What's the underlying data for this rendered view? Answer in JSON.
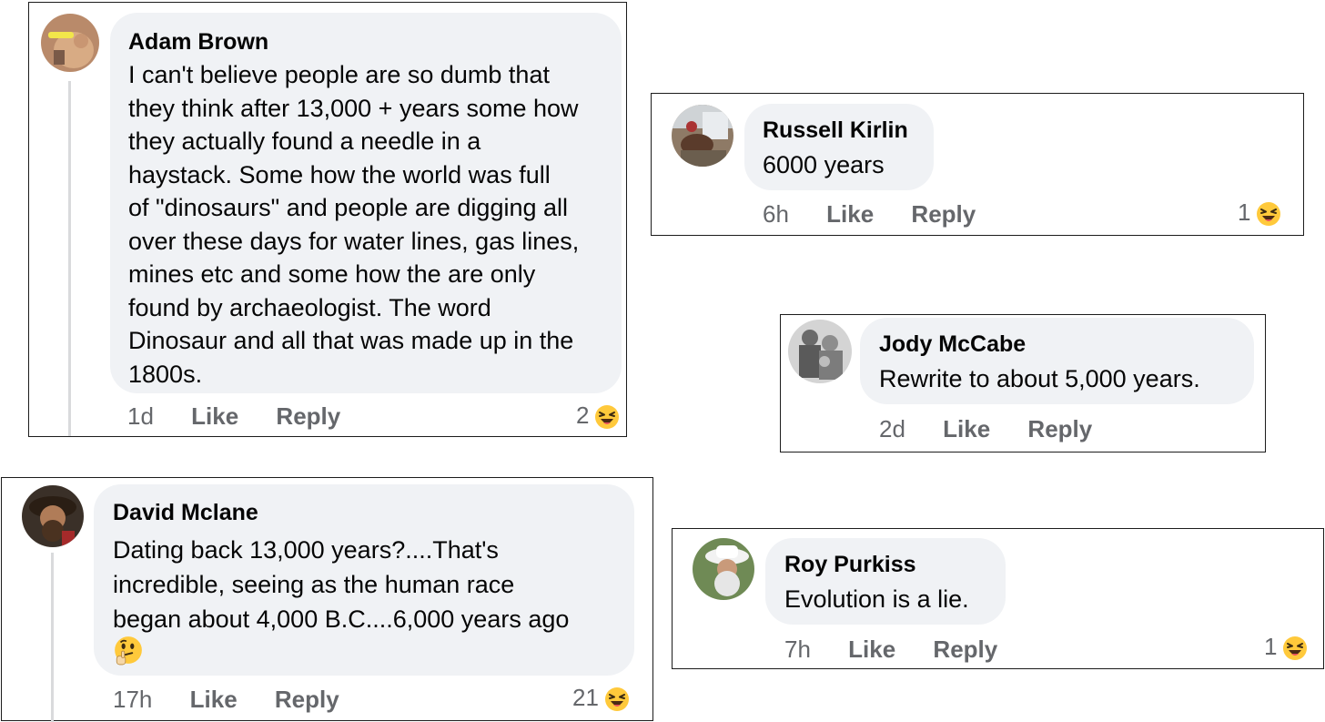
{
  "comments": [
    {
      "name": "Adam Brown",
      "text": "I can't believe people are so dumb that\nthey think after 13,000 + years some how\nthey actually found a needle in a\nhaystack. Some how the world was full\nof \"dinosaurs\" and people are digging all\nover these days for water lines, gas lines,\nmines etc and some how the are only\nfound by archaeologist.  The word\nDinosaur and all that was made up in the\n1800s.",
      "time": "1d",
      "like": "Like",
      "reply": "Reply",
      "reactions": "2",
      "reaction_icon": "laughing-emoji-icon"
    },
    {
      "name": "Russell Kirlin",
      "text": "6000 years",
      "time": "6h",
      "like": "Like",
      "reply": "Reply",
      "reactions": "1",
      "reaction_icon": "laughing-emoji-icon"
    },
    {
      "name": "Jody McCabe",
      "text": "Rewrite to about 5,000 years.",
      "time": "2d",
      "like": "Like",
      "reply": "Reply"
    },
    {
      "name": "David Mclane",
      "text": "Dating back 13,000 years?....That's\nincredible, seeing as the human race\nbegan about 4,000 B.C....6,000 years ago",
      "emoji": "thinking-face-icon",
      "time": "17h",
      "like": "Like",
      "reply": "Reply",
      "reactions": "21",
      "reaction_icon": "laughing-emoji-icon"
    },
    {
      "name": "Roy Purkiss",
      "text": "Evolution is a lie.",
      "time": "7h",
      "like": "Like",
      "reply": "Reply",
      "reactions": "1",
      "reaction_icon": "laughing-emoji-icon"
    }
  ],
  "colors": {
    "bubble": "#f0f2f5",
    "meta": "#65676b",
    "border": "#1c1c1c",
    "emoji_yellow": "#ffc93b"
  }
}
